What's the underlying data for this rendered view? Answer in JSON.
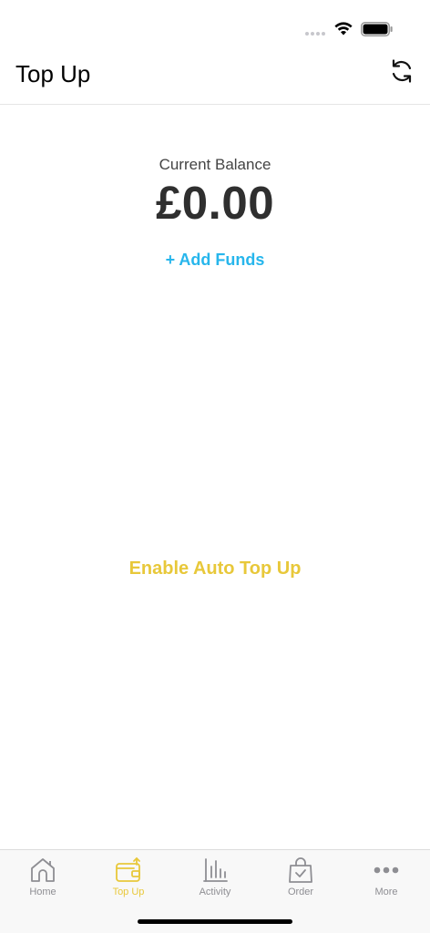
{
  "header": {
    "title": "Top Up"
  },
  "balance": {
    "label": "Current Balance",
    "value": "£0.00",
    "add_funds": "+ Add Funds"
  },
  "auto_top_up": {
    "label": "Enable Auto Top Up"
  },
  "tabs": [
    {
      "label": "Home",
      "icon": "home-icon"
    },
    {
      "label": "Top Up",
      "icon": "wallet-icon",
      "active": true
    },
    {
      "label": "Activity",
      "icon": "bar-chart-icon"
    },
    {
      "label": "Order",
      "icon": "shopping-bag-icon"
    },
    {
      "label": "More",
      "icon": "more-dots-icon"
    }
  ],
  "colors": {
    "accent_blue": "#27b6ec",
    "accent_yellow": "#e8c83a",
    "tab_inactive": "#8e8e93",
    "balance_text": "#2f2f2f"
  }
}
